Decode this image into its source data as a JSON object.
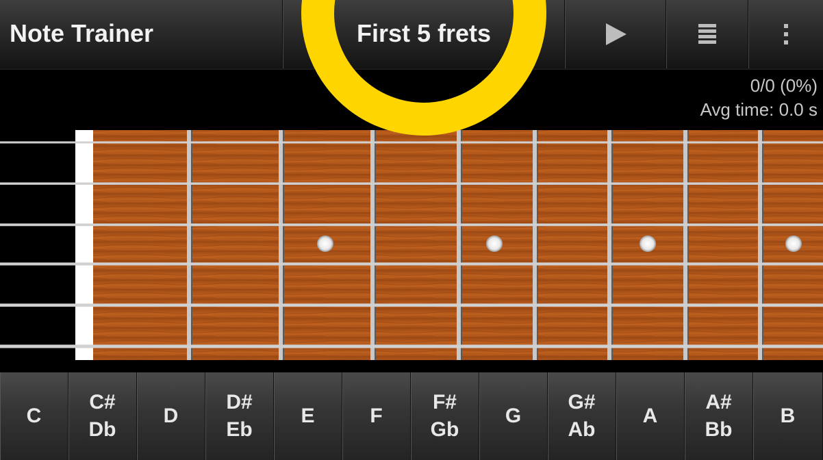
{
  "toolbar": {
    "app_title": "Note Trainer",
    "mode_title": "First 5 frets",
    "play_icon": "play-icon",
    "list_icon": "list-icon",
    "overflow_icon": "overflow-menu-icon"
  },
  "score": {
    "ratio": "0/0 (0%)",
    "avg_time": "Avg time: 0.0 s"
  },
  "fretboard": {
    "strings": 6,
    "inlay_frets": [
      3,
      5,
      7,
      9
    ],
    "colors": {
      "wood": "#b4581a",
      "string": "#d0d0d0",
      "fret": "#c8c8c8",
      "nut": "#ffffff"
    }
  },
  "notes": [
    {
      "lines": [
        "C"
      ]
    },
    {
      "lines": [
        "C#",
        "Db"
      ]
    },
    {
      "lines": [
        "D"
      ]
    },
    {
      "lines": [
        "D#",
        "Eb"
      ]
    },
    {
      "lines": [
        "E"
      ]
    },
    {
      "lines": [
        "F"
      ]
    },
    {
      "lines": [
        "F#",
        "Gb"
      ]
    },
    {
      "lines": [
        "G"
      ]
    },
    {
      "lines": [
        "G#",
        "Ab"
      ]
    },
    {
      "lines": [
        "A"
      ]
    },
    {
      "lines": [
        "A#",
        "Bb"
      ]
    },
    {
      "lines": [
        "B"
      ]
    }
  ],
  "highlight_color": "#ffd500"
}
